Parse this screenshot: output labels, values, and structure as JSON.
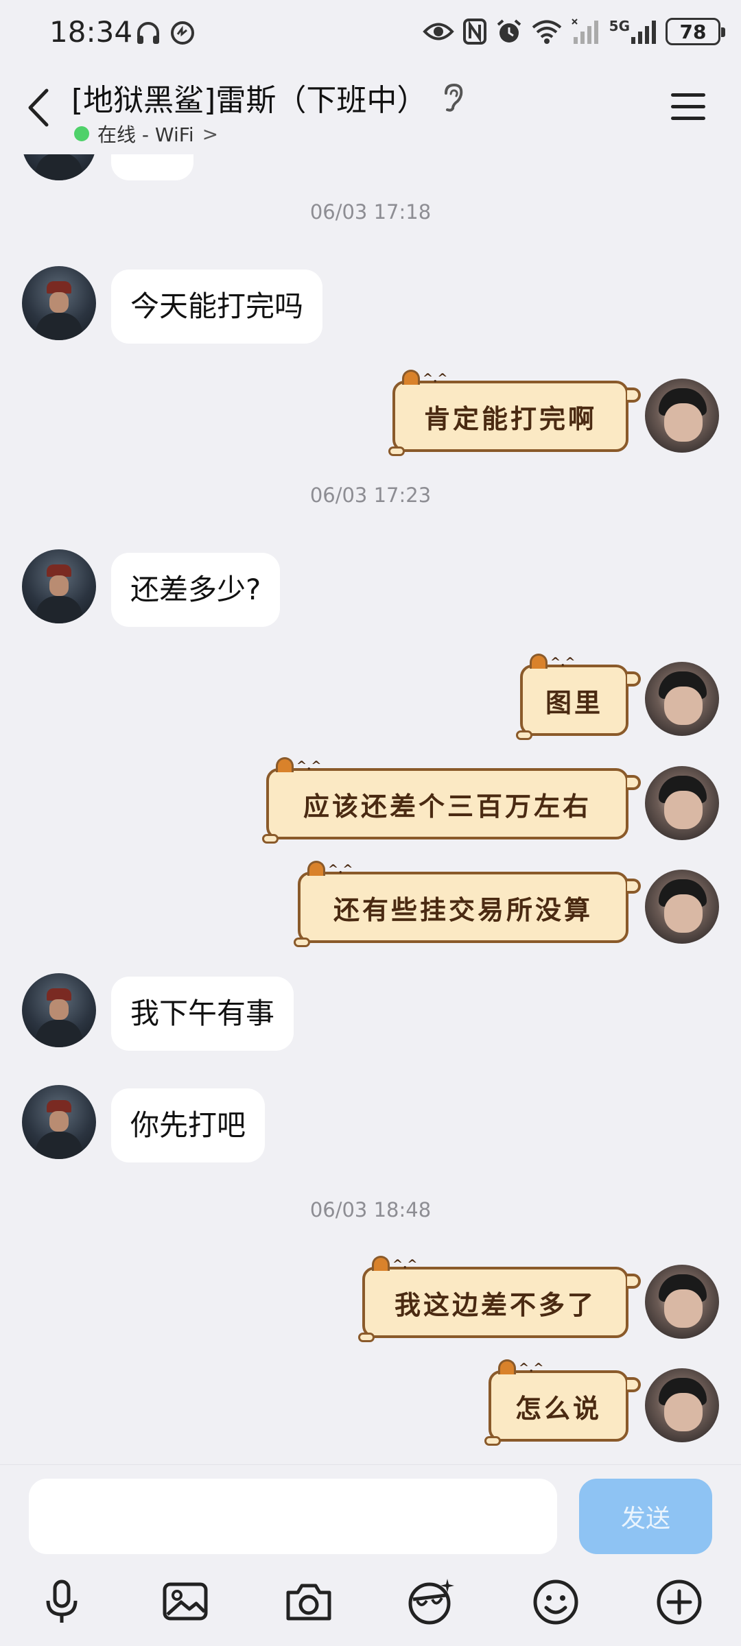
{
  "status_bar": {
    "time": "18:34",
    "network_label": "5G",
    "battery": "78"
  },
  "header": {
    "back_label": "<",
    "contact_name": "[地狱黑鲨]雷斯（下班中）",
    "online_status": "在线 - WiFi",
    "status_chevron": ">"
  },
  "colors": {
    "accent_send": "#8ec3f3",
    "online_dot": "#4fd16a",
    "sticker_bubble": "#fbe9c4"
  },
  "messages": [
    {
      "type": "timestamp",
      "text": "06/03 17:18"
    },
    {
      "type": "left",
      "text": "今天能打完吗"
    },
    {
      "type": "right",
      "text": "肯定能打完啊"
    },
    {
      "type": "timestamp",
      "text": "06/03 17:23"
    },
    {
      "type": "left",
      "text": "还差多少?"
    },
    {
      "type": "right",
      "text": "图里"
    },
    {
      "type": "right",
      "text": "应该还差个三百万左右"
    },
    {
      "type": "right",
      "text": "还有些挂交易所没算"
    },
    {
      "type": "left",
      "text": "我下午有事"
    },
    {
      "type": "left",
      "text": "你先打吧"
    },
    {
      "type": "timestamp",
      "text": "06/03 18:48"
    },
    {
      "type": "right",
      "text": "我这边差不多了"
    },
    {
      "type": "right",
      "text": "怎么说"
    }
  ],
  "composer": {
    "input_value": "",
    "send_label": "发送"
  },
  "toolbar": {
    "icons": [
      "microphone-icon",
      "image-icon",
      "camera-icon",
      "sticker-icon",
      "emoji-icon",
      "plus-icon"
    ]
  }
}
